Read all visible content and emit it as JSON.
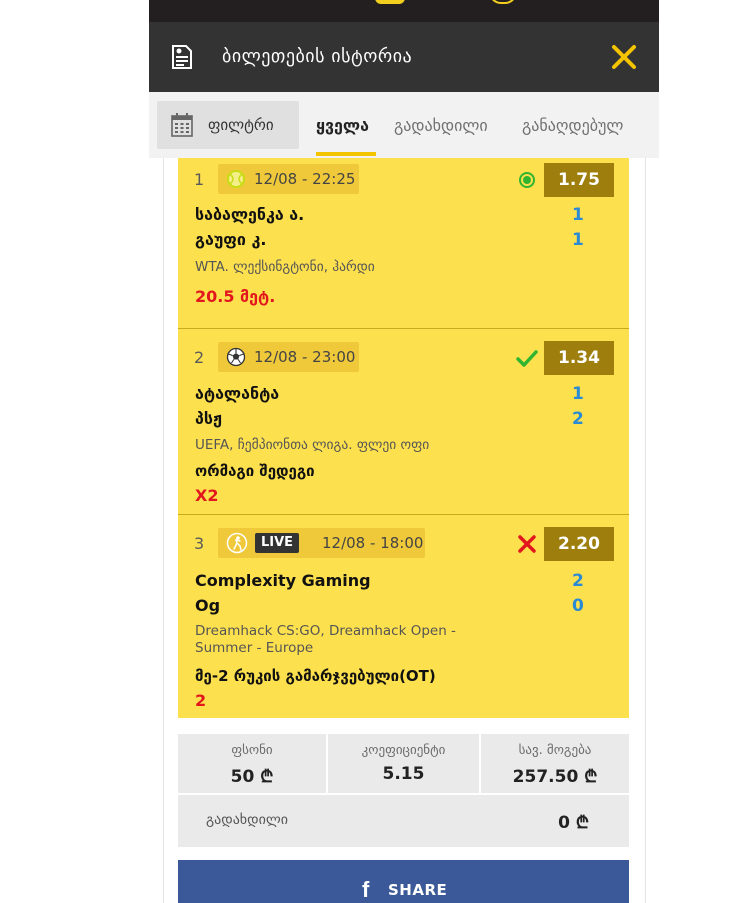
{
  "header": {
    "title": "ბილეთების ისტორია",
    "icon": "receipt-icon",
    "close_icon": "close-icon",
    "accent": "#f5c400"
  },
  "filter": {
    "label": "ფილტრი",
    "icon": "calendar-icon"
  },
  "tabs": [
    {
      "label": "ყველა",
      "active": true
    },
    {
      "label": "გადახდილი",
      "active": false
    },
    {
      "label": "განაღდებულ",
      "active": false
    }
  ],
  "bets": [
    {
      "number": "1",
      "sport_icon": "tennis-ball-icon",
      "live": "",
      "datetime": "12/08 - 22:25",
      "status_icon": "pending-dot-icon",
      "odds": "1.75",
      "team1": "საბალენკა ა.",
      "team2": "გაუფი კ.",
      "score1": "1",
      "score2": "1",
      "league": "WTA. ლექსინგტონი, ჰარდი",
      "market": "",
      "pick": "20.5 მეტ."
    },
    {
      "number": "2",
      "sport_icon": "soccer-ball-icon",
      "live": "",
      "datetime": "12/08 - 23:00",
      "status_icon": "won-check-icon",
      "odds": "1.34",
      "team1": "ატალანტა",
      "team2": "პსჟ",
      "score1": "1",
      "score2": "2",
      "league": "UEFA, ჩემპიონთა ლიგა. ფლეი ოფი",
      "market": "ორმაგი შედეგი",
      "pick": "X2"
    },
    {
      "number": "3",
      "sport_icon": "esports-icon",
      "live": "LIVE",
      "datetime": "12/08 - 18:00",
      "status_icon": "lost-cross-icon",
      "odds": "2.20",
      "team1": "Complexity Gaming",
      "team2": "Og",
      "score1": "2",
      "score2": "0",
      "league": "Dreamhack CS:GO, Dreamhack Open - Summer - Europe",
      "market": "მე-2 რუკის გამარჯვებული(OT)",
      "pick": "2"
    }
  ],
  "summary": {
    "stake_label": "ფსონი",
    "stake_value": "50 ₾",
    "coef_label": "კოეფიციენტი",
    "coef_value": "5.15",
    "win_label": "სავ. მოგება",
    "win_value": "257.50 ₾",
    "paid_label": "გადახდილი",
    "paid_value": "0 ₾"
  },
  "share": {
    "label": "SHARE",
    "icon": "facebook-icon"
  },
  "colors": {
    "card": "#fde04d",
    "odds_bg": "#9e7f0e",
    "pick": "#e2161d",
    "score": "#2a8ad4",
    "won": "#2fb52f",
    "lost": "#e2161d",
    "facebook": "#3b5998"
  }
}
